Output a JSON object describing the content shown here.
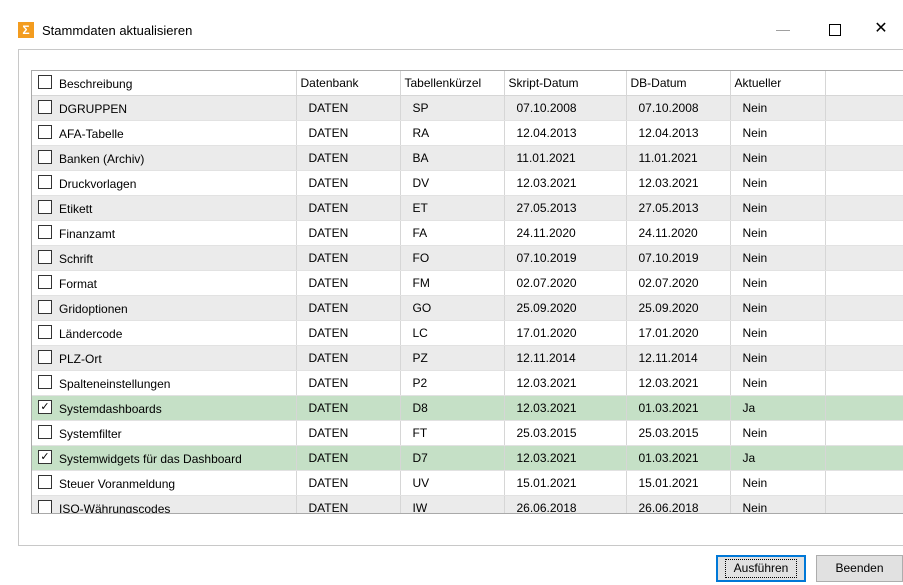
{
  "window": {
    "title": "Stammdaten aktualisieren",
    "icon": "sigma-app-icon",
    "minimize": "—",
    "close": "✕"
  },
  "table": {
    "columns": [
      "Beschreibung",
      "Datenbank",
      "Tabellenkürzel",
      "Skript-Datum",
      "DB-Datum",
      "Aktueller"
    ],
    "rows": [
      {
        "checked": false,
        "desc": "DGRUPPEN",
        "db": "DATEN",
        "code": "SP",
        "script_date": "07.10.2008",
        "db_date": "07.10.2008",
        "current": "Nein"
      },
      {
        "checked": false,
        "desc": "AFA-Tabelle",
        "db": "DATEN",
        "code": "RA",
        "script_date": "12.04.2013",
        "db_date": "12.04.2013",
        "current": "Nein"
      },
      {
        "checked": false,
        "desc": "Banken (Archiv)",
        "db": "DATEN",
        "code": "BA",
        "script_date": "11.01.2021",
        "db_date": "11.01.2021",
        "current": "Nein"
      },
      {
        "checked": false,
        "desc": "Druckvorlagen",
        "db": "DATEN",
        "code": "DV",
        "script_date": "12.03.2021",
        "db_date": "12.03.2021",
        "current": "Nein"
      },
      {
        "checked": false,
        "desc": "Etikett",
        "db": "DATEN",
        "code": "ET",
        "script_date": "27.05.2013",
        "db_date": "27.05.2013",
        "current": "Nein"
      },
      {
        "checked": false,
        "desc": "Finanzamt",
        "db": "DATEN",
        "code": "FA",
        "script_date": "24.11.2020",
        "db_date": "24.11.2020",
        "current": "Nein"
      },
      {
        "checked": false,
        "desc": "Schrift",
        "db": "DATEN",
        "code": "FO",
        "script_date": "07.10.2019",
        "db_date": "07.10.2019",
        "current": "Nein"
      },
      {
        "checked": false,
        "desc": "Format",
        "db": "DATEN",
        "code": "FM",
        "script_date": "02.07.2020",
        "db_date": "02.07.2020",
        "current": "Nein"
      },
      {
        "checked": false,
        "desc": "Gridoptionen",
        "db": "DATEN",
        "code": "GO",
        "script_date": "25.09.2020",
        "db_date": "25.09.2020",
        "current": "Nein"
      },
      {
        "checked": false,
        "desc": "Ländercode",
        "db": "DATEN",
        "code": "LC",
        "script_date": "17.01.2020",
        "db_date": "17.01.2020",
        "current": "Nein"
      },
      {
        "checked": false,
        "desc": "PLZ-Ort",
        "db": "DATEN",
        "code": "PZ",
        "script_date": "12.11.2014",
        "db_date": "12.11.2014",
        "current": "Nein"
      },
      {
        "checked": false,
        "desc": "Spalteneinstellungen",
        "db": "DATEN",
        "code": "P2",
        "script_date": "12.03.2021",
        "db_date": "12.03.2021",
        "current": "Nein"
      },
      {
        "checked": true,
        "desc": "Systemdashboards",
        "db": "DATEN",
        "code": "D8",
        "script_date": "12.03.2021",
        "db_date": "01.03.2021",
        "current": "Ja"
      },
      {
        "checked": false,
        "desc": "Systemfilter",
        "db": "DATEN",
        "code": "FT",
        "script_date": "25.03.2015",
        "db_date": "25.03.2015",
        "current": "Nein"
      },
      {
        "checked": true,
        "desc": "Systemwidgets für das Dashboard",
        "db": "DATEN",
        "code": "D7",
        "script_date": "12.03.2021",
        "db_date": "01.03.2021",
        "current": "Ja"
      },
      {
        "checked": false,
        "desc": "Steuer Voranmeldung",
        "db": "DATEN",
        "code": "UV",
        "script_date": "15.01.2021",
        "db_date": "15.01.2021",
        "current": "Nein"
      },
      {
        "checked": false,
        "desc": "ISO-Währungscodes",
        "db": "DATEN",
        "code": "IW",
        "script_date": "26.06.2018",
        "db_date": "26.06.2018",
        "current": "Nein"
      }
    ],
    "selected_row_color": "#c5e0c6",
    "alt_row_color": "#ebebeb"
  },
  "buttons": {
    "run": "Ausführen",
    "end": "Beenden"
  },
  "colors": {
    "app_icon": "#f39c1f",
    "default_button_border": "#0078d7"
  }
}
